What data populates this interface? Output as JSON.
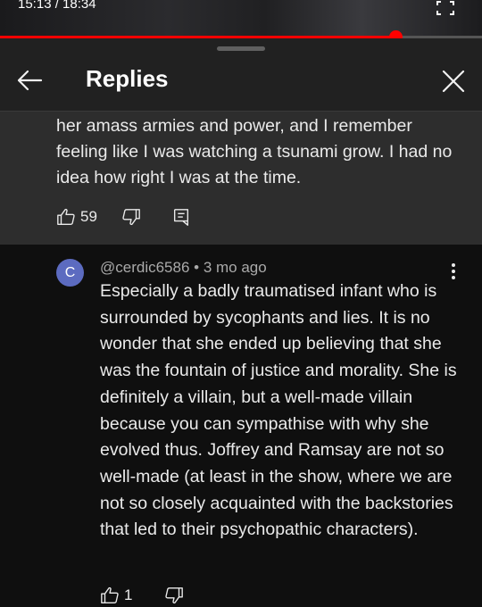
{
  "video": {
    "time_display": "15:13 / 18:34",
    "progress_fraction": 0.82,
    "progress_color": "#ff0000"
  },
  "panel": {
    "title": "Replies",
    "back_icon": "arrow-left-icon",
    "close_icon": "close-icon"
  },
  "parent_comment": {
    "text": "her amass armies and power, and I remember feeling like I was watching a tsunami grow. I had no idea how right I was at the time.",
    "likes": "59"
  },
  "reply": {
    "avatar_letter": "C",
    "avatar_color": "#5c6bc0",
    "meta": "@cerdic6586 • 3 mo ago",
    "text": "Especially a badly traumatised infant who is surrounded by sycophants and lies. It is no wonder that she ended up believing that she was the fountain of justice and morality. She is definitely a villain, but a well-made villain because you can sympathise with why she evolved thus. Joffrey and Ramsay are not so well-made (at least in the show, where we are not so closely acquainted with the backstories that led to their psychopathic characters).",
    "likes": "1"
  }
}
